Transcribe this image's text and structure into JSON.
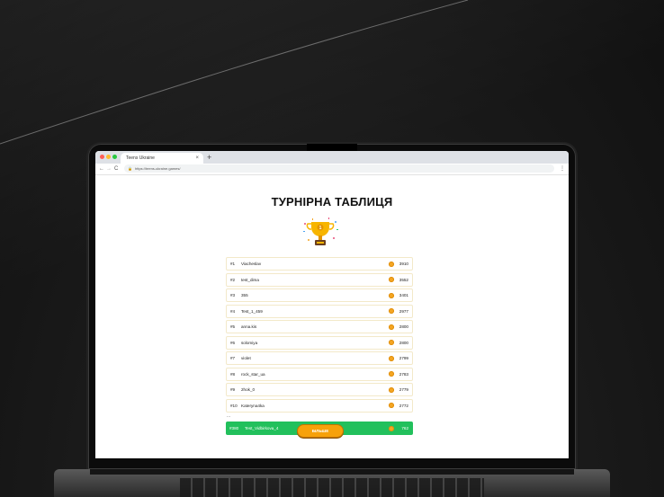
{
  "browser": {
    "tab_title": "Teens Ukraine",
    "tab_close": "×",
    "new_tab": "+",
    "nav_back": "←",
    "nav_forward": "→",
    "nav_reload": "C",
    "url": "https://teens-ukraine.games/",
    "menu": "⋮"
  },
  "page": {
    "title": "ТУРНІРНА ТАБЛИЦЯ",
    "trophy_icon": "trophy-icon",
    "leaderboard": [
      {
        "rank": "#1",
        "name": "Viacheslav",
        "score": "3910"
      },
      {
        "rank": "#2",
        "name": "test_dima",
        "score": "3552"
      },
      {
        "rank": "#3",
        "name": "355",
        "score": "3401"
      },
      {
        "rank": "#4",
        "name": "Test_1_459",
        "score": "2977"
      },
      {
        "rank": "#5",
        "name": "anna.kis",
        "score": "2800"
      },
      {
        "rank": "#6",
        "name": "solomiya",
        "score": "2800"
      },
      {
        "rank": "#7",
        "name": "violet",
        "score": "2799"
      },
      {
        "rank": "#8",
        "name": "rock_star_ua",
        "score": "2783"
      },
      {
        "rank": "#9",
        "name": "2hok_0",
        "score": "2779"
      },
      {
        "rank": "#10",
        "name": "Kateryna4ka",
        "score": "2772"
      }
    ],
    "ellipsis": "...",
    "current_user": {
      "rank": "#380",
      "name": "Test_Vidbirkova_4",
      "score": "762"
    },
    "more_button": "БІЛЬШЕ"
  },
  "colors": {
    "highlight_row": "#22c05c",
    "button": "#f7a10a",
    "coin": "#f5a623",
    "row_border": "#f3e9c9"
  }
}
